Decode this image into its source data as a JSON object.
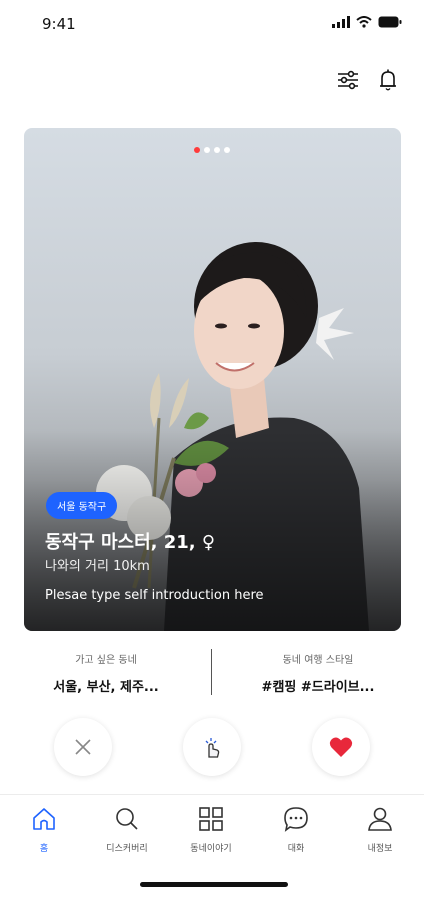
{
  "status_bar": {
    "time": "9:41"
  },
  "header": {
    "filter_icon": "filter-icon",
    "bell_icon": "bell-icon"
  },
  "profile": {
    "location_badge": "서울 동작구",
    "name_line": "동작구 마스터, 21, ♀",
    "distance": "나와의 거리 10km",
    "intro": "Plesae type self introduction here",
    "photo_count": 4,
    "active_photo": 1
  },
  "info": {
    "left": {
      "label": "가고 싶은 동네",
      "value": "서울, 부산, 제주..."
    },
    "right": {
      "label": "동네 여행 스타일",
      "value": "#캠핑  #드라이브..."
    }
  },
  "actions": {
    "dislike": "close-icon",
    "superlike": "point-icon",
    "like": "heart-icon",
    "like_color": "#e8283b"
  },
  "nav": {
    "items": [
      {
        "label": "홈",
        "icon": "home-icon"
      },
      {
        "label": "디스커버리",
        "icon": "search-icon"
      },
      {
        "label": "동네이야기",
        "icon": "grid-icon"
      },
      {
        "label": "대화",
        "icon": "chat-icon"
      },
      {
        "label": "내정보",
        "icon": "user-icon"
      }
    ],
    "accent": "#1e63ff"
  }
}
